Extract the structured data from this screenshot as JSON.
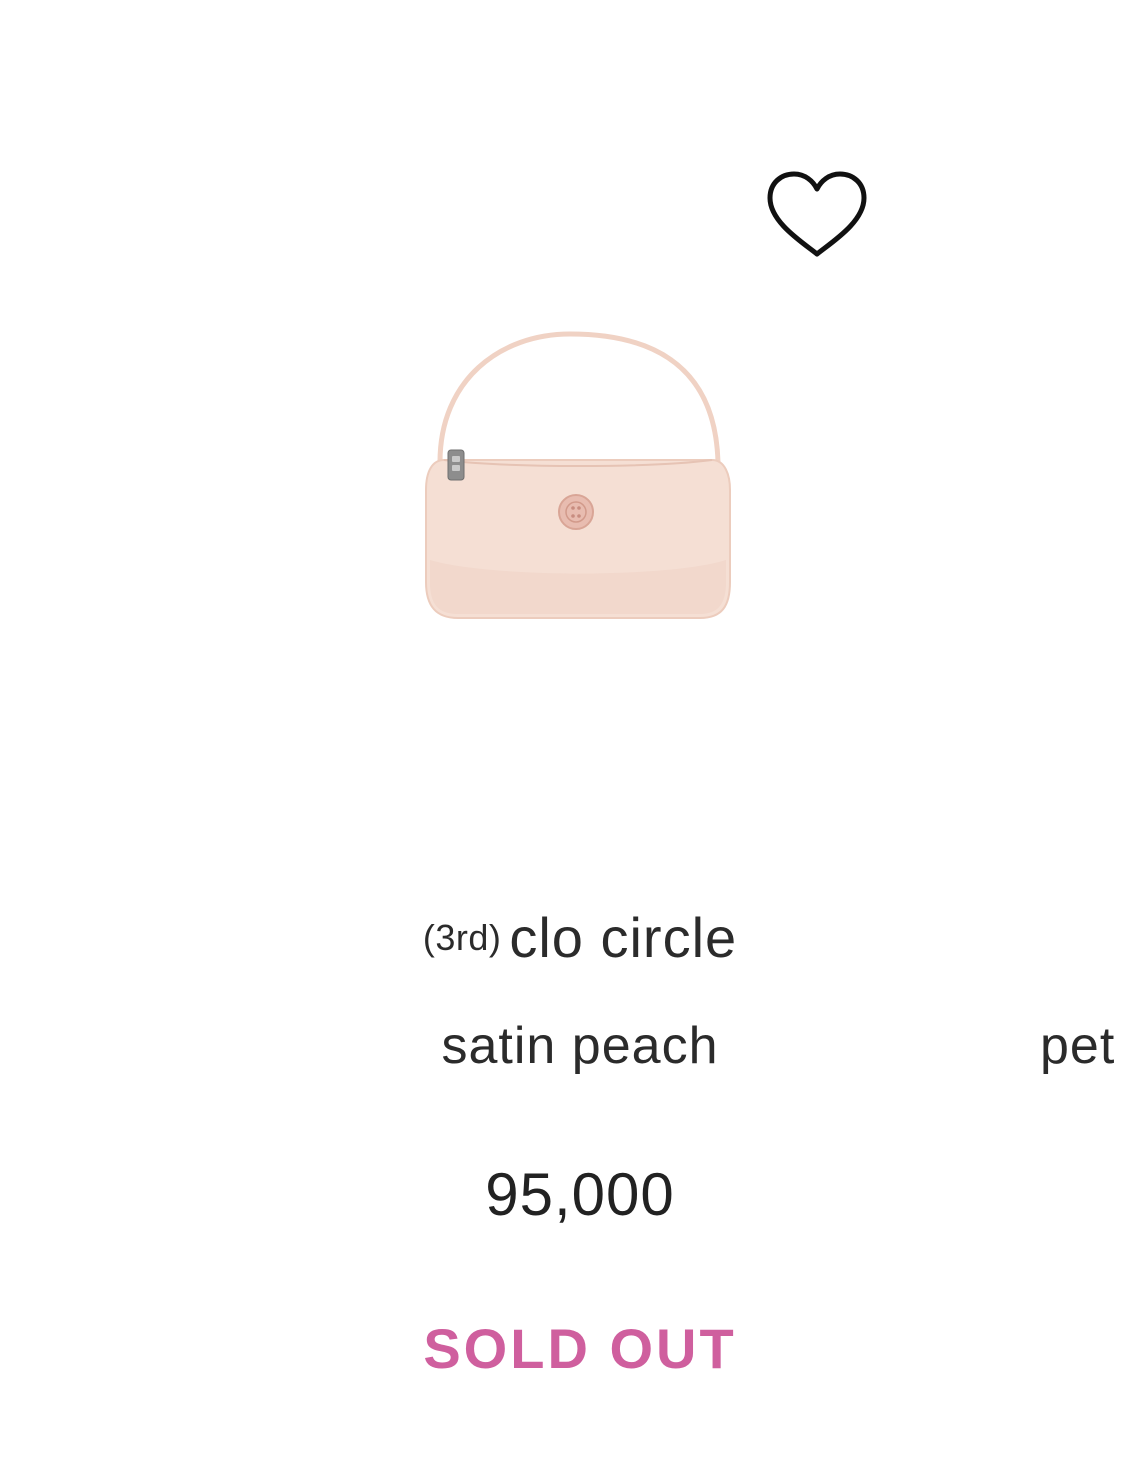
{
  "product": {
    "title_prefix": "(3rd)",
    "title": "clo circle",
    "subtitle": "satin peach",
    "price": "95,000",
    "status": "SOLD OUT",
    "image_icon": "handbag-product-image",
    "wishlist_icon": "heart-outline-icon"
  },
  "next_card": {
    "peek_text": "pet"
  },
  "colors": {
    "text": "#2b2b2b",
    "sold_out": "#cf5f9e",
    "bag_body": "#f3d9cc",
    "bag_accent": "#e7b9ac"
  }
}
